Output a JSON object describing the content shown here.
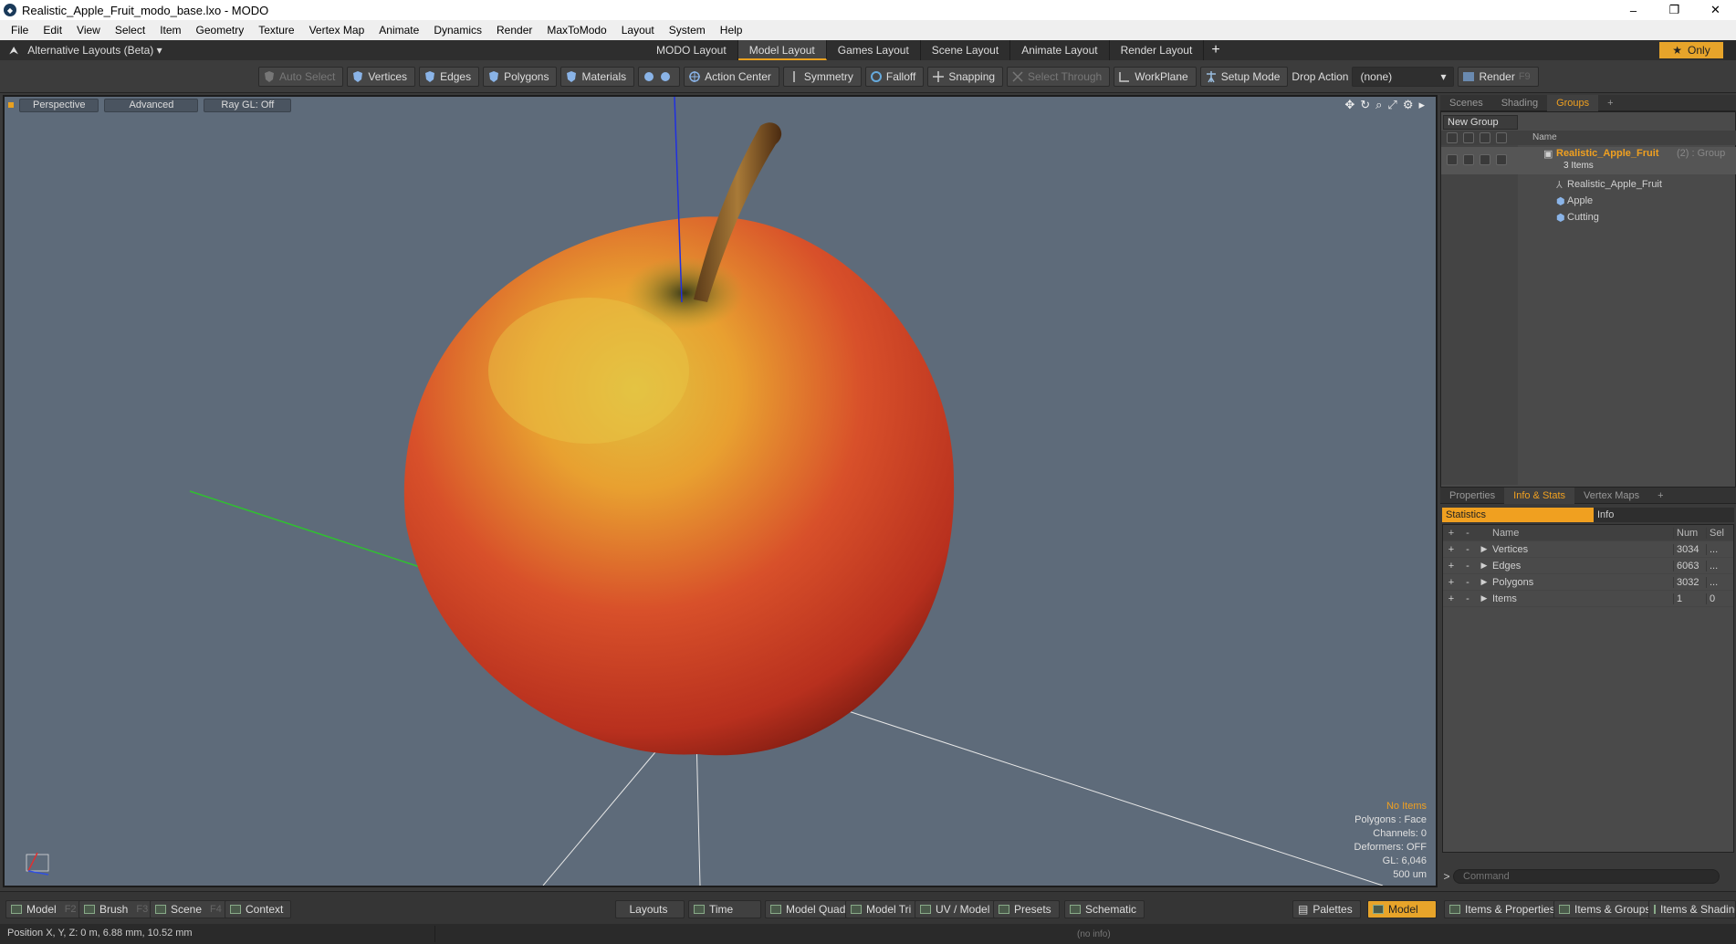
{
  "window": {
    "title": "Realistic_Apple_Fruit_modo_base.lxo - MODO",
    "minimize": "–",
    "maximize": "❐",
    "close": "✕"
  },
  "menu": [
    "File",
    "Edit",
    "View",
    "Select",
    "Item",
    "Geometry",
    "Texture",
    "Vertex Map",
    "Animate",
    "Dynamics",
    "Render",
    "MaxToModo",
    "Layout",
    "System",
    "Help"
  ],
  "layoutbar": {
    "alt_layout": "Alternative Layouts (Beta) ▾",
    "tabs": [
      "MODO Layout",
      "Model Layout",
      "Games Layout",
      "Scene Layout",
      "Animate Layout",
      "Render Layout"
    ],
    "active_tab": "Model Layout",
    "only": "Only"
  },
  "toolbar": {
    "auto_select": "Auto Select",
    "vertices": "Vertices",
    "edges": "Edges",
    "polygons": "Polygons",
    "materials": "Materials",
    "action_center": "Action Center",
    "symmetry": "Symmetry",
    "falloff": "Falloff",
    "snapping": "Snapping",
    "select_through": "Select Through",
    "workplane": "WorkPlane",
    "setup_mode": "Setup Mode",
    "drop_action_label": "Drop Action",
    "drop_action_value": "(none)",
    "render": "Render",
    "render_key": "F9"
  },
  "viewport": {
    "view": "Perspective",
    "shading": "Advanced",
    "raygl": "Ray GL: Off",
    "info": {
      "items": "No Items",
      "polygons": "Polygons : Face",
      "channels": "Channels: 0",
      "deformers": "Deformers: OFF",
      "gl": "GL: 6,046",
      "scale": "500 um"
    }
  },
  "groups_panel": {
    "tabs": [
      "Scenes",
      "Shading",
      "Groups"
    ],
    "active_tab": "Groups",
    "new_group": "New Group",
    "name_header": "Name",
    "group": {
      "name": "Realistic_Apple_Fruit",
      "meta": "(2) : Group",
      "count": "3 Items"
    },
    "items": [
      "Realistic_Apple_Fruit",
      "Apple",
      "Cutting"
    ]
  },
  "props_panel": {
    "tabs": [
      "Properties",
      "Info & Stats",
      "Vertex Maps"
    ],
    "active_tab": "Info & Stats",
    "stat_tabs": [
      "Statistics",
      "Info"
    ],
    "headers": {
      "name": "Name",
      "num": "Num",
      "sel": "Sel"
    },
    "rows": [
      {
        "name": "Vertices",
        "num": "3034",
        "sel": "..."
      },
      {
        "name": "Edges",
        "num": "6063",
        "sel": "..."
      },
      {
        "name": "Polygons",
        "num": "3032",
        "sel": "..."
      },
      {
        "name": "Items",
        "num": "1",
        "sel": "0"
      }
    ],
    "command_placeholder": "Command"
  },
  "bottombar": {
    "model": "Model",
    "model_key": "F2",
    "brush": "Brush",
    "brush_key": "F3",
    "scene": "Scene",
    "scene_key": "F4",
    "context": "Context",
    "layouts": "Layouts",
    "time": "Time",
    "model_quad": "Model Quad",
    "model_tri": "Model Tri",
    "uv_model": "UV / Model",
    "presets": "Presets",
    "schematic": "Schematic",
    "palettes": "Palettes",
    "model_right": "Model",
    "items_properties": "Items & Properties",
    "items_groups": "Items & Groups",
    "items_shading": "Items & Shading"
  },
  "status": {
    "position": "Position X, Y, Z:   0 m, 6.88 mm, 10.52 mm",
    "noinfo": "(no info)"
  },
  "colors": {
    "accent": "#f0a020",
    "viewport_bg": "#5e6b7a"
  }
}
